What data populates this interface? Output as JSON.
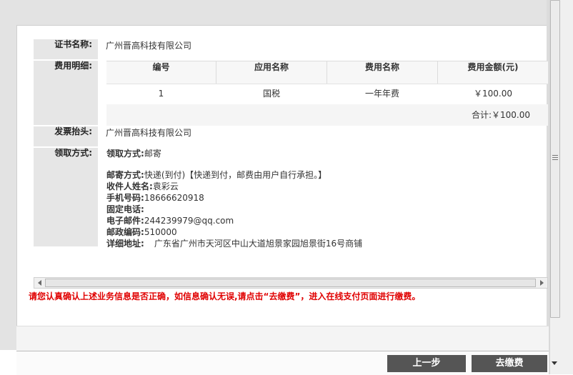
{
  "form": {
    "cert_name_label": "证书名称:",
    "cert_name_value": "广州晋高科技有限公司",
    "fee_detail_label": "费用明细:",
    "invoice_label": "发票抬头:",
    "invoice_value": "广州晋高科技有限公司",
    "pickup_label": "领取方式:"
  },
  "fee_table": {
    "headers": [
      "编号",
      "应用名称",
      "费用名称",
      "费用金额(元)"
    ],
    "rows": [
      [
        "1",
        "国税",
        "一年年费",
        "￥100.00"
      ]
    ],
    "total": "合计:￥100.00"
  },
  "pickup": {
    "method_label": "领取方式:",
    "method_value": "邮寄",
    "mail_label": "邮寄方式:",
    "mail_value": "快递(到付)【快递到付，邮费由用户自行承担。】",
    "recipient_label": "收件人姓名:",
    "recipient_value": "袁彩云",
    "phone_label": "手机号码:",
    "phone_value": "18666620918",
    "landline_label": "固定电话:",
    "landline_value": "",
    "email_label": "电子邮件:",
    "email_value": "244239979@qq.com",
    "zip_label": "邮政编码:",
    "zip_value": "510000",
    "address_label": "详细地址:",
    "address_value": "广东省广州市天河区中山大道旭景家园旭景街16号商铺"
  },
  "notice": "请您认真确认上述业务信息是否正确，如信息确认无误,请点击“去缴费”，进入在线支付页面进行缴费。",
  "buttons": {
    "prev": "上一步",
    "pay": "去缴费"
  },
  "colors": {
    "notice": "#e00000",
    "button_bg": "#555555",
    "label_bg": "#e6e6e6"
  }
}
